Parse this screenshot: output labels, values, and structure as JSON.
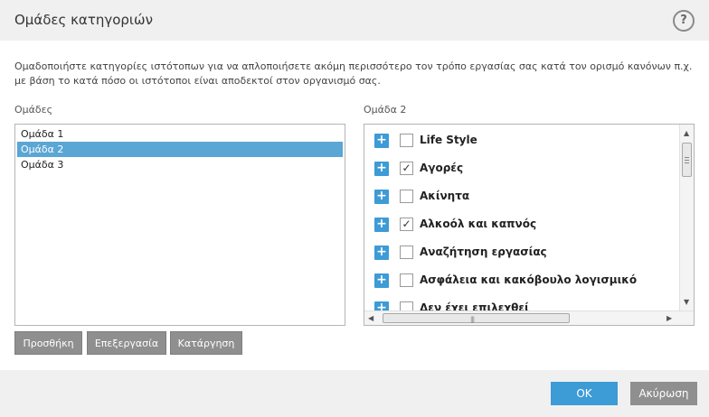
{
  "window": {
    "title": "Ομάδες κατηγοριών",
    "help_label": "?"
  },
  "description": "Ομαδοποιήστε κατηγορίες ιστότοπων για να απλοποιήσετε ακόμη περισσότερο τον τρόπο εργασίας σας κατά τον ορισμό κανόνων π.χ. με βάση το κατά πόσο οι ιστότοποι είναι αποδεκτοί στον οργανισμό σας.",
  "groups": {
    "label": "Ομάδες",
    "items": [
      {
        "label": "Ομάδα 1",
        "selected": false
      },
      {
        "label": "Ομάδα 2",
        "selected": true
      },
      {
        "label": "Ομάδα 3",
        "selected": false
      }
    ],
    "buttons": {
      "add": "Προσθήκη",
      "edit": "Επεξεργασία",
      "remove": "Κατάργηση"
    }
  },
  "categories": {
    "label": "Ομάδα 2",
    "items": [
      {
        "label": "Life Style",
        "checked": false
      },
      {
        "label": "Αγορές",
        "checked": true
      },
      {
        "label": "Ακίνητα",
        "checked": false
      },
      {
        "label": "Αλκοόλ και καπνός",
        "checked": true
      },
      {
        "label": "Αναζήτηση εργασίας",
        "checked": false
      },
      {
        "label": "Ασφάλεια και κακόβουλο λογισμικό",
        "checked": false
      },
      {
        "label": "Δεν έχει επιλεχθεί",
        "checked": false
      }
    ]
  },
  "footer": {
    "ok": "OK",
    "cancel": "Ακύρωση"
  },
  "colors": {
    "accent": "#3d9bd6",
    "selection": "#5aa6d5",
    "secondary_button": "#8f8f8f"
  }
}
